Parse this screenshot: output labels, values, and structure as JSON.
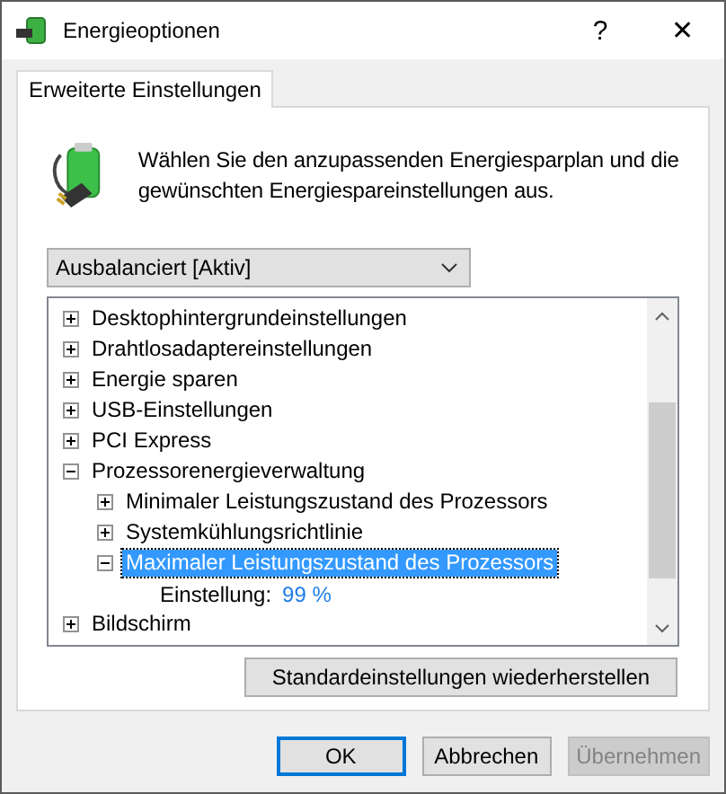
{
  "window": {
    "title": "Energieoptionen",
    "help": "?",
    "close": "✕"
  },
  "tabs": [
    {
      "label": "Erweiterte Einstellungen",
      "selected": true
    }
  ],
  "description": "Wählen Sie den anzupassenden Energiesparplan und die gewünschten Energiespareinstellungen aus.",
  "plan_dropdown": {
    "value": "Ausbalanciert [Aktiv]"
  },
  "tree": [
    {
      "label": "Desktophintergrundeinstellungen",
      "expanded": false,
      "selected": false
    },
    {
      "label": "Drahtlosadaptereinstellungen",
      "expanded": false,
      "selected": false
    },
    {
      "label": "Energie sparen",
      "expanded": false,
      "selected": false
    },
    {
      "label": "USB-Einstellungen",
      "expanded": false,
      "selected": false
    },
    {
      "label": "PCI Express",
      "expanded": false,
      "selected": false
    },
    {
      "label": "Prozessorenergieverwaltung",
      "expanded": true,
      "selected": false,
      "children": [
        {
          "label": "Minimaler Leistungszustand des Prozessors",
          "expanded": false,
          "selected": false
        },
        {
          "label": "Systemkühlungsrichtlinie",
          "expanded": false,
          "selected": false
        },
        {
          "label": "Maximaler Leistungszustand des Prozessors",
          "expanded": true,
          "selected": true,
          "setting": {
            "label": "Einstellung:",
            "value": "99 %"
          }
        }
      ]
    },
    {
      "label": "Bildschirm",
      "expanded": false,
      "selected": false
    }
  ],
  "restore_button": "Standardeinstellungen wiederherstellen",
  "buttons": [
    {
      "label": "OK",
      "default": true,
      "disabled": false
    },
    {
      "label": "Abbrechen",
      "default": false,
      "disabled": false
    },
    {
      "label": "Übernehmen",
      "default": false,
      "disabled": true
    }
  ]
}
